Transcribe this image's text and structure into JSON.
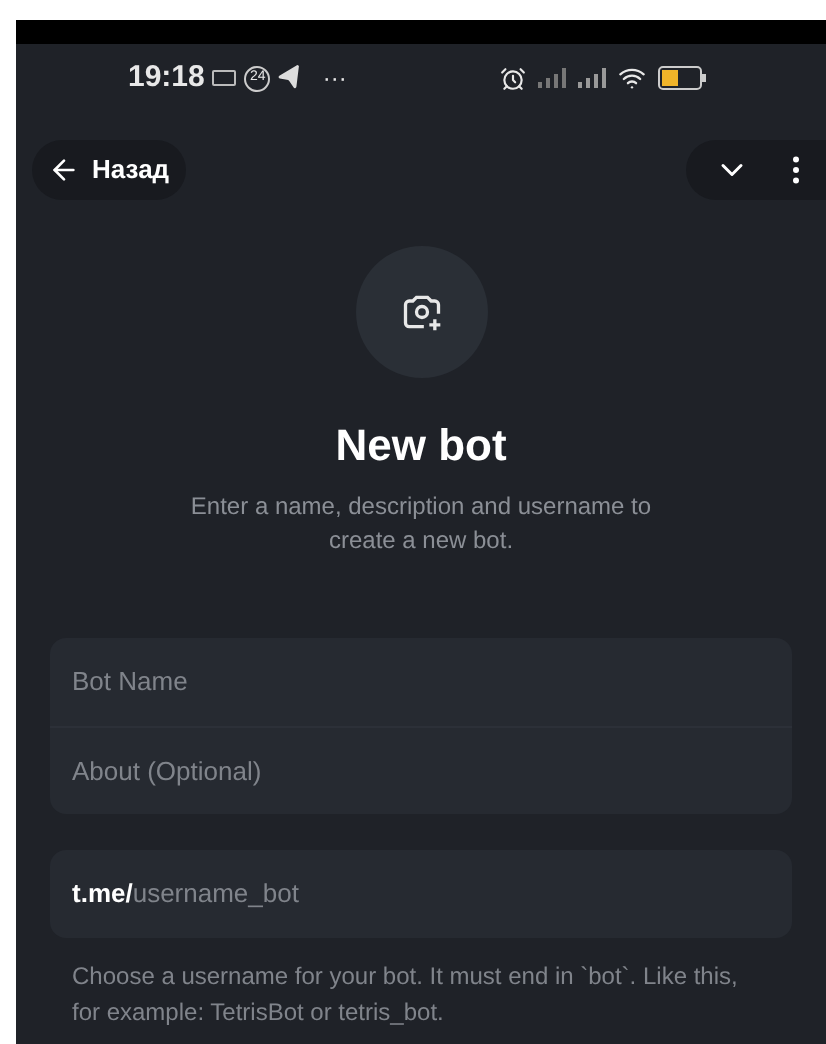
{
  "status_bar": {
    "time": "19:18",
    "badge": "24",
    "more": "···"
  },
  "nav": {
    "back_label": "Назад"
  },
  "header": {
    "title": "New bot",
    "subtitle": "Enter a name, description and username to create a new bot."
  },
  "fields": [
    {
      "placeholder": "Bot Name"
    },
    {
      "placeholder": "About (Optional)"
    }
  ],
  "username": {
    "prefix": "t.me/",
    "placeholder": "username_bot"
  },
  "hint": "Choose a username for your bot. It must end in `bot`. Like this, for example: TetrisBot or tetris_bot."
}
